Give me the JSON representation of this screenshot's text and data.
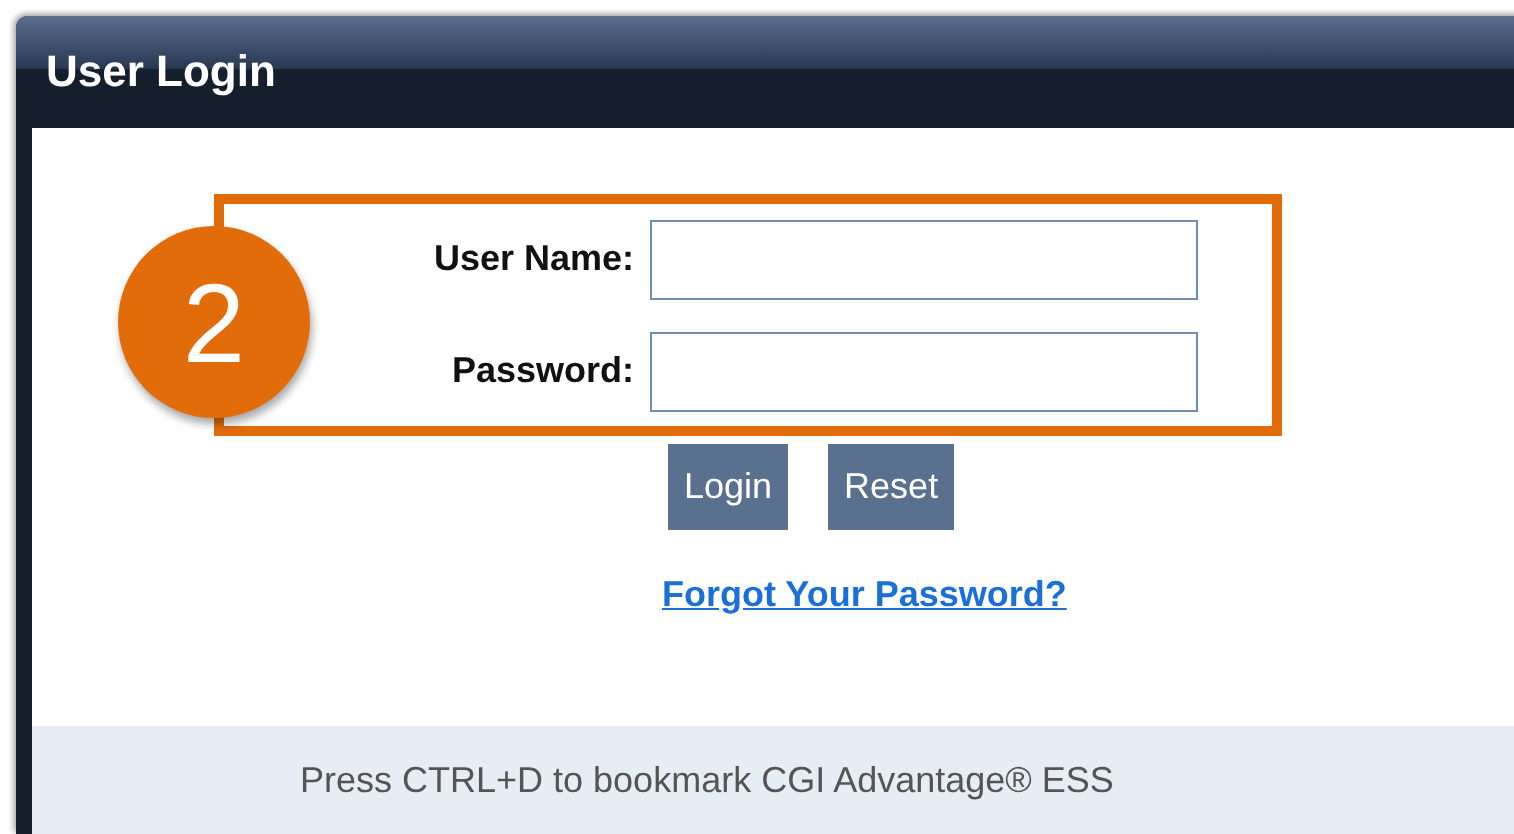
{
  "window": {
    "title": "User Login"
  },
  "step_badge": "2",
  "fields": [
    {
      "label": "User Name:"
    },
    {
      "label": "Password:"
    }
  ],
  "buttons": [
    "Login",
    "Reset"
  ],
  "link": "Forgot Your Password?",
  "footer": "Press CTRL+D to bookmark CGI Advantage® ESS"
}
